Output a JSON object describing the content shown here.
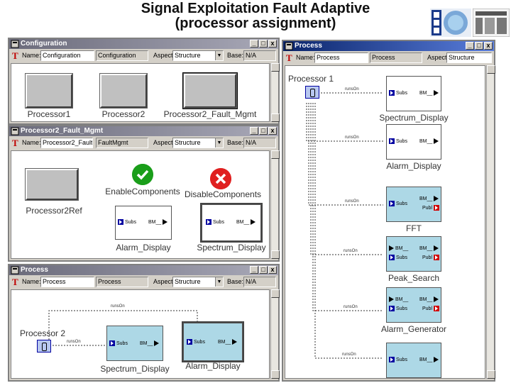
{
  "slide": {
    "title_line1": "Signal Exploitation Fault Adaptive",
    "title_line2": "(processor assignment)"
  },
  "windows": {
    "configuration": {
      "title": "Configuration",
      "name_label": "Name:",
      "name_value": "Configuration",
      "kind_value": "Configuration",
      "aspect_label": "Aspect:",
      "aspect_value": "Structure",
      "base_label": "Base:",
      "base_value": "N/A",
      "boxes": [
        "Processor1",
        "Processor2",
        "Processor2_Fault_Mgmt"
      ]
    },
    "fault_mgmt": {
      "title": "Processor2_Fault_Mgmt",
      "name_label": "Name:",
      "name_value": "Processor2_Fault_",
      "kind_value": "FaultMgmt",
      "aspect_label": "Aspect:",
      "aspect_value": "Structure",
      "base_label": "Base:",
      "base_value": "N/A",
      "ref_label": "Processor2Ref",
      "enable_label": "EnableComponents",
      "disable_label": "DisableComponents",
      "components": [
        {
          "label": "Alarm_Display",
          "in_port": "Subs",
          "out_port": "BM__"
        },
        {
          "label": "Spectrum_Display",
          "in_port": "Subs",
          "out_port": "BM__"
        }
      ]
    },
    "process_small": {
      "title": "Process",
      "name_label": "Name:",
      "name_value": "Process",
      "kind_value": "Process",
      "aspect_label": "Aspect:",
      "aspect_value": "Structure",
      "base_label": "Base:",
      "base_value": "N/A",
      "processor_label": "Processor 2",
      "wire_label": "runsOn",
      "components": [
        {
          "label": "Spectrum_Display",
          "in_port": "Subs",
          "out_port": "BM__"
        },
        {
          "label": "Alarm_Display",
          "in_port": "Subs",
          "out_port": "BM__"
        }
      ]
    },
    "process_large": {
      "title": "Process",
      "name_label": "Name:",
      "name_value": "Process",
      "kind_value": "Process",
      "aspect_label": "Aspect:",
      "aspect_value": "Structure",
      "processor_label": "Processor 1",
      "wire_label": "runsOn",
      "components": [
        {
          "label": "Spectrum_Display",
          "ports": [
            "Subs",
            "BM__"
          ]
        },
        {
          "label": "Alarm_Display",
          "ports": [
            "Subs",
            "BM__"
          ]
        },
        {
          "label": "FFT",
          "ports": [
            "Subs",
            "BM__",
            "Publ"
          ]
        },
        {
          "label": "Peak_Search",
          "ports": [
            "BM__",
            "Subs",
            "BM__",
            "Publ"
          ]
        },
        {
          "label": "Alarm_Generator",
          "ports": [
            "BM__",
            "Subs",
            "BM__",
            "Publ"
          ]
        },
        {
          "label": "",
          "ports": [
            "Subs",
            "BM__"
          ]
        }
      ]
    }
  },
  "window_buttons": {
    "minimize": "_",
    "restore": "□",
    "close": "x"
  },
  "tool_marker": "T",
  "colors": {
    "title_active": "#0a246a",
    "component_blue": "#add8e6",
    "accent_red": "#d00000",
    "port_blue": "#0000a0"
  },
  "icons": {
    "sri_logo": "sri-logo",
    "isis_logo": "isis-logo",
    "check": "check-icon",
    "cross": "cross-icon"
  }
}
